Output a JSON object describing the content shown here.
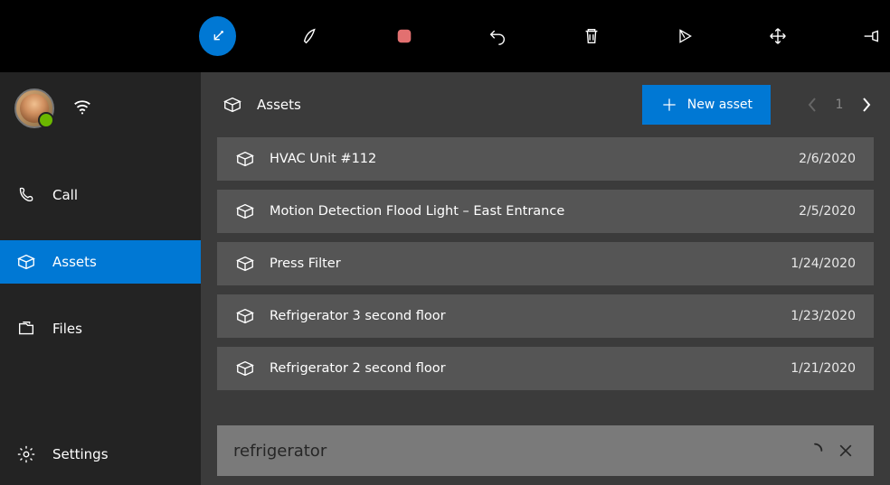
{
  "toolbar": {
    "items": [
      "ink-arrow",
      "pencil",
      "stop-record",
      "undo",
      "delete",
      "play",
      "move",
      "pin"
    ]
  },
  "sidebar": {
    "nav": [
      {
        "icon": "phone",
        "label": "Call"
      },
      {
        "icon": "asset-box",
        "label": "Assets"
      },
      {
        "icon": "files",
        "label": "Files"
      }
    ],
    "settings_label": "Settings"
  },
  "content": {
    "title": "Assets",
    "new_button_label": "New asset",
    "page_number": "1",
    "assets": [
      {
        "name": "HVAC Unit #112",
        "date": "2/6/2020"
      },
      {
        "name": "Motion Detection Flood Light – East Entrance",
        "date": "2/5/2020"
      },
      {
        "name": "Press Filter",
        "date": "1/24/2020"
      },
      {
        "name": "Refrigerator 3 second floor",
        "date": "1/23/2020"
      },
      {
        "name": "Refrigerator 2 second floor",
        "date": "1/21/2020"
      }
    ],
    "search_value": "refrigerator"
  }
}
